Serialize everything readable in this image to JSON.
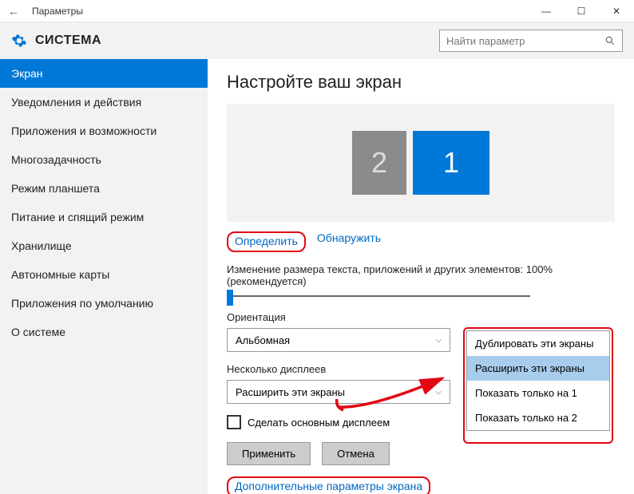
{
  "window": {
    "title": "Параметры"
  },
  "header": {
    "section": "СИСТЕМА",
    "search_placeholder": "Найти параметр"
  },
  "sidebar": {
    "items": [
      {
        "label": "Экран",
        "active": true
      },
      {
        "label": "Уведомления и действия"
      },
      {
        "label": "Приложения и возможности"
      },
      {
        "label": "Многозадачность"
      },
      {
        "label": "Режим планшета"
      },
      {
        "label": "Питание и спящий режим"
      },
      {
        "label": "Хранилище"
      },
      {
        "label": "Автономные карты"
      },
      {
        "label": "Приложения по умолчанию"
      },
      {
        "label": "О системе"
      }
    ]
  },
  "page": {
    "title": "Настройте ваш экран",
    "monitors": {
      "m2": "2",
      "m1": "1"
    },
    "identify": "Определить",
    "detect": "Обнаружить",
    "scale_label": "Изменение размера текста, приложений и других элементов: 100% (рекомендуется)",
    "orientation_label": "Ориентация",
    "orientation_value": "Альбомная",
    "multi_label": "Несколько дисплеев",
    "multi_value": "Расширить эти экраны",
    "make_main": "Сделать основным дисплеем",
    "apply": "Применить",
    "cancel": "Отмена",
    "advanced": "Дополнительные параметры экрана",
    "dropdown": {
      "opt0": "Дублировать эти экраны",
      "opt1": "Расширить эти экраны",
      "opt2": "Показать только на 1",
      "opt3": "Показать только на 2"
    }
  }
}
